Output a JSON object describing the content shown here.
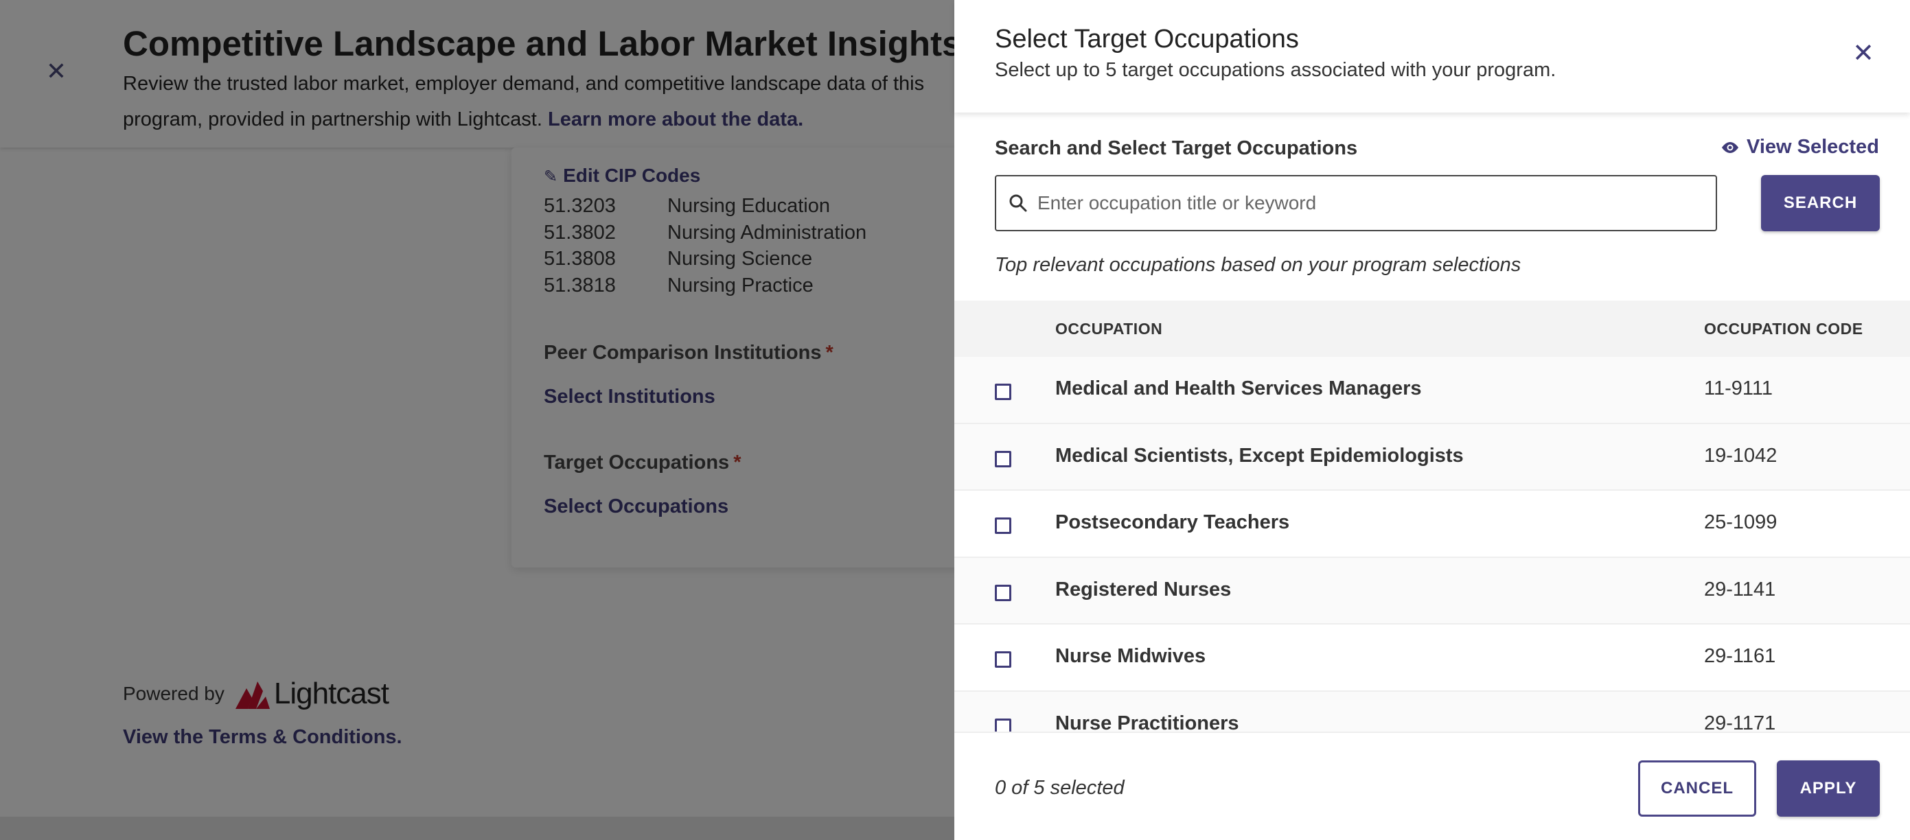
{
  "background": {
    "title": "Competitive Landscape and Labor Market Insights",
    "description": "Review the trusted labor market, employer demand, and competitive landscape data of this program, provided in partnership with Lightcast.",
    "learn_more": "Learn more about the data.",
    "edit_cip": "Edit CIP Codes",
    "cip_codes": [
      {
        "code": "51.3203",
        "name": "Nursing Education"
      },
      {
        "code": "51.3802",
        "name": "Nursing Administration"
      },
      {
        "code": "51.3808",
        "name": "Nursing Science"
      },
      {
        "code": "51.3818",
        "name": "Nursing Practice"
      }
    ],
    "peer_label": "Peer Comparison Institutions",
    "peer_link": "Select Institutions",
    "target_label": "Target Occupations",
    "target_link": "Select Occupations",
    "required_mark": "*",
    "powered_by": "Powered by",
    "brand": "Lightcast",
    "terms": "View the Terms & Conditions."
  },
  "drawer": {
    "title": "Select Target Occupations",
    "subtitle": "Select up to 5 target occupations associated with your program.",
    "search_label": "Search and Select Target Occupations",
    "view_selected": "View Selected",
    "search_placeholder": "Enter occupation title or keyword",
    "search_button": "SEARCH",
    "hint": "Top relevant occupations based on your program selections",
    "columns": {
      "occupation": "OCCUPATION",
      "code": "OCCUPATION CODE"
    },
    "rows": [
      {
        "occupation": "Medical and Health Services Managers",
        "code": "11-9111"
      },
      {
        "occupation": "Medical Scientists, Except Epidemiologists",
        "code": "19-1042"
      },
      {
        "occupation": "Postsecondary Teachers",
        "code": "25-1099"
      },
      {
        "occupation": "Registered Nurses",
        "code": "29-1141"
      },
      {
        "occupation": "Nurse Midwives",
        "code": "29-1161"
      },
      {
        "occupation": "Nurse Practitioners",
        "code": "29-1171"
      }
    ],
    "selected_count": "0 of 5 selected",
    "cancel": "CANCEL",
    "apply": "APPLY"
  },
  "colors": {
    "accent": "#4b4687",
    "link": "#3f3b78",
    "required": "#c0392b",
    "brand_mark": "#c8102e"
  }
}
